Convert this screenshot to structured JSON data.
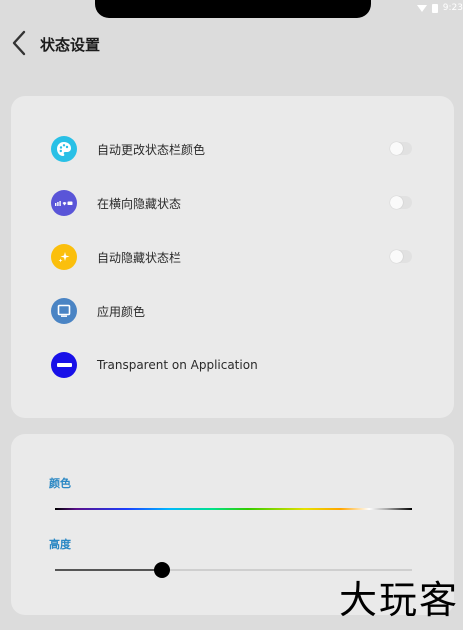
{
  "status_bar": {
    "time": "9:23"
  },
  "header": {
    "title": "状态设置"
  },
  "settings": {
    "items": [
      {
        "label": "自动更改状态栏颜色",
        "icon": "palette-icon",
        "color": "#29c0e6",
        "has_toggle": true,
        "enabled": false
      },
      {
        "label": "在横向隐藏状态",
        "icon": "statusbar-landscape-icon",
        "color": "#5a55d8",
        "has_toggle": true,
        "enabled": false
      },
      {
        "label": "自动隐藏状态栏",
        "icon": "sparkle-icon",
        "color": "#fbbf0c",
        "has_toggle": true,
        "enabled": false
      },
      {
        "label": "应用颜色",
        "icon": "monitor-icon",
        "color": "#4a84c4",
        "has_toggle": false
      },
      {
        "label": "Transparent on Application",
        "icon": "minus-icon",
        "color": "#1810e8",
        "has_toggle": false
      }
    ]
  },
  "appearance": {
    "color_label": "颜色",
    "height_label": "高度",
    "height_value": 0.3
  },
  "watermark": "大玩客"
}
